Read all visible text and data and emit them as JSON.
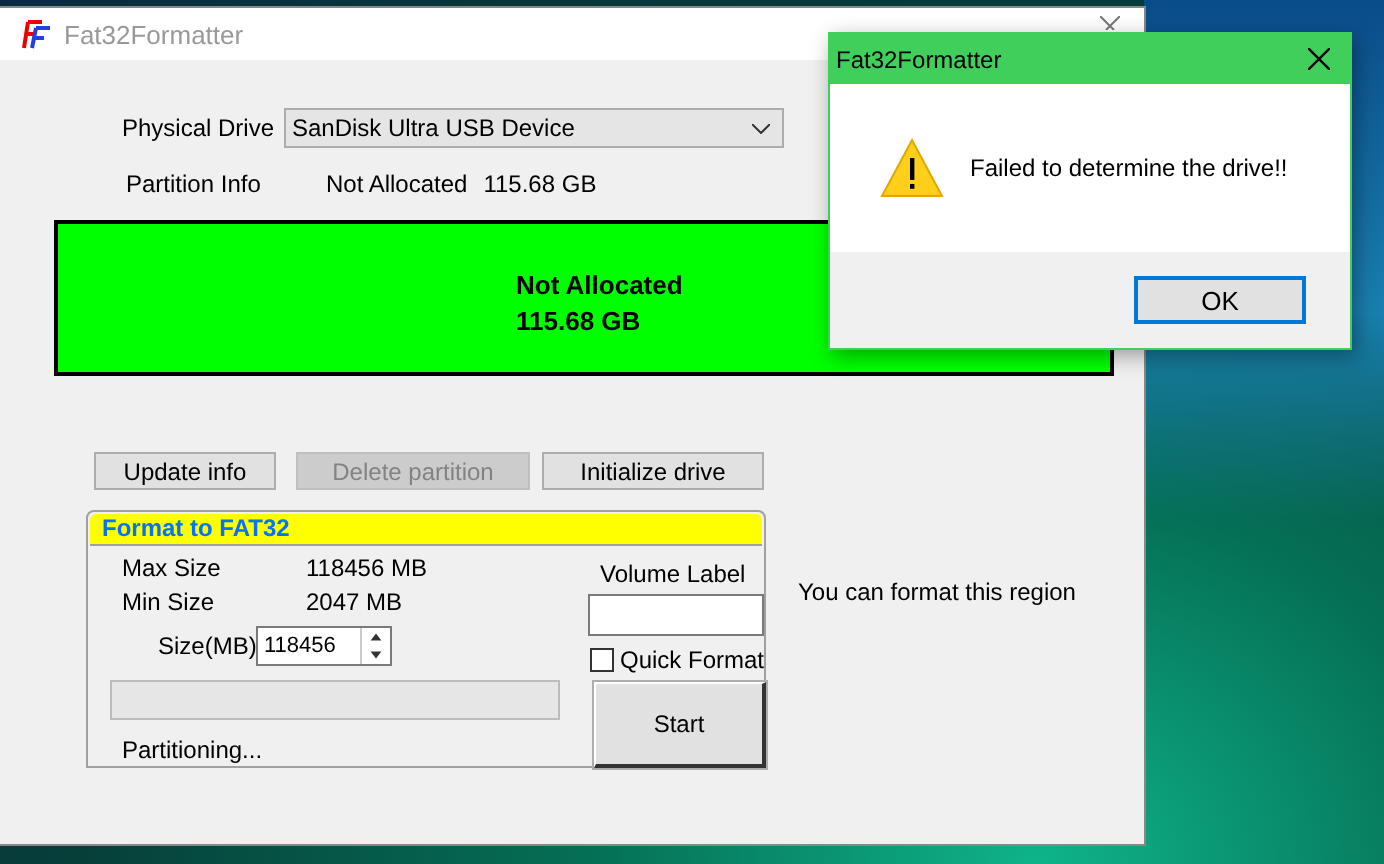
{
  "main_window": {
    "title": "Fat32Formatter"
  },
  "physical_drive": {
    "label": "Physical Drive",
    "value": "SanDisk Ultra USB Device"
  },
  "partition_info": {
    "label": "Partition Info",
    "status": "Not Allocated",
    "size": "115.68 GB"
  },
  "partition_map": {
    "status": "Not Allocated",
    "size": "115.68 GB"
  },
  "buttons": [
    {
      "label": "Update info",
      "disabled": false
    },
    {
      "label": "Delete partition",
      "disabled": true
    },
    {
      "label": "Initialize drive",
      "disabled": false
    }
  ],
  "format_group": {
    "title": "Format to FAT32",
    "max_size": {
      "label": "Max Size",
      "value": "118456 MB"
    },
    "min_size": {
      "label": "Min Size",
      "value": "2047 MB"
    },
    "size": {
      "label": "Size(MB)",
      "value": "118456"
    },
    "progress": {
      "level": 0
    },
    "status": "Partitioning...",
    "volume_label": {
      "label": "Volume Label"
    },
    "quick_format": {
      "label": "Quick Format",
      "checked": false
    },
    "start_button": "Start"
  },
  "hint": "You can format this region",
  "dialog": {
    "title": "Fat32Formatter",
    "message": "Failed to determine the drive!!",
    "button": "OK"
  }
}
